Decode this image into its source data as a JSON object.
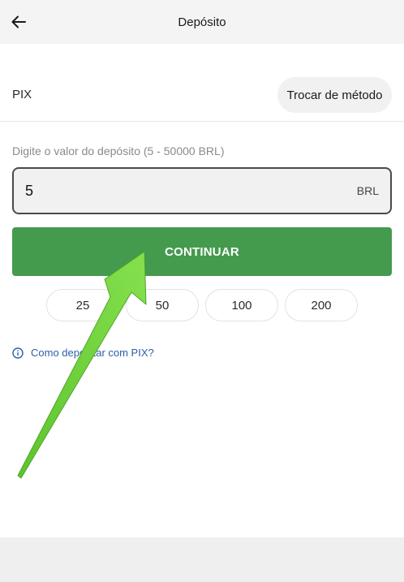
{
  "header": {
    "title": "Depósito",
    "back_icon": "arrow-left-icon"
  },
  "payment_method": {
    "current": "PIX",
    "change_label": "Trocar de método"
  },
  "amount": {
    "label": "Digite o valor do depósito (5 - 50000 BRL)",
    "value": "5",
    "currency": "BRL"
  },
  "continue_label": "CONTINUAR",
  "quick_amounts": [
    "25",
    "50",
    "100",
    "200"
  ],
  "help": {
    "icon": "info-icon",
    "text": "Como depositar com PIX?"
  },
  "colors": {
    "primary_button": "#449a4d",
    "link": "#2a5fa8",
    "arrow_annotation": "#6fd23f"
  }
}
